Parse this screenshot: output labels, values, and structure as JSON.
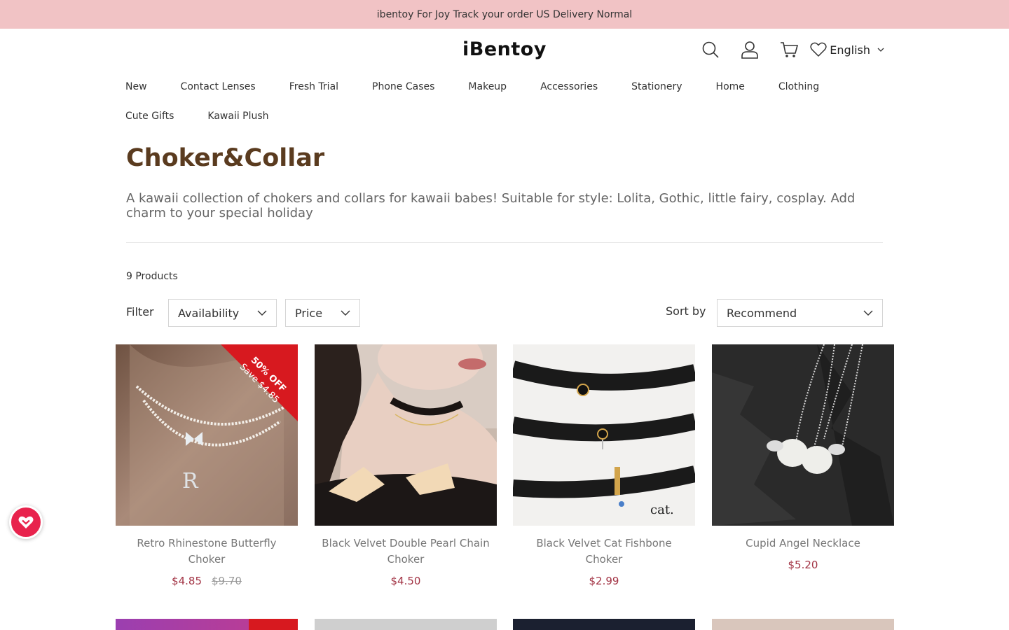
{
  "announcement": "ibentoy For Joy Track your order  US Delivery Normal",
  "header": {
    "logo": "iBentoy",
    "language": "English"
  },
  "nav": [
    "New",
    "Contact Lenses",
    "Fresh Trial",
    "Phone Cases",
    "Makeup",
    "Accessories",
    "Stationery",
    "Home",
    "Clothing",
    "Cute Gifts",
    "Kawaii Plush"
  ],
  "collection": {
    "title": "Choker&Collar",
    "description": "A kawaii collection of chokers and collars for kawaii babes! Suitable for style: Lolita, Gothic, little fairy, cosplay. Add charm to your special holiday",
    "count": "9 Products"
  },
  "filters": {
    "label": "Filter",
    "availability": "Availability",
    "price": "Price",
    "sort_label": "Sort by",
    "sort_value": "Recommend"
  },
  "products": [
    {
      "title": "Retro Rhinestone Butterfly Choker",
      "price": "$4.85",
      "compare": "$9.70",
      "badge_pct": "50% OFF",
      "badge_save": "Save $4.85"
    },
    {
      "title": "Black Velvet Double Pearl Chain Choker",
      "price": "$4.50"
    },
    {
      "title": "Black Velvet Cat Fishbone Choker",
      "price": "$2.99",
      "image_caption": "cat."
    },
    {
      "title": "Cupid Angel Necklace",
      "price": "$5.20"
    }
  ],
  "colors": {
    "announce_bg": "#f1c3c5",
    "title": "#5a3b1f",
    "price": "#a23344",
    "sale_badge": "#d7191f",
    "float_button": "#e8234d"
  },
  "icons": [
    "search-icon",
    "account-icon",
    "cart-icon",
    "wishlist-heart-icon",
    "chevron-down-icon",
    "rewards-icon"
  ]
}
